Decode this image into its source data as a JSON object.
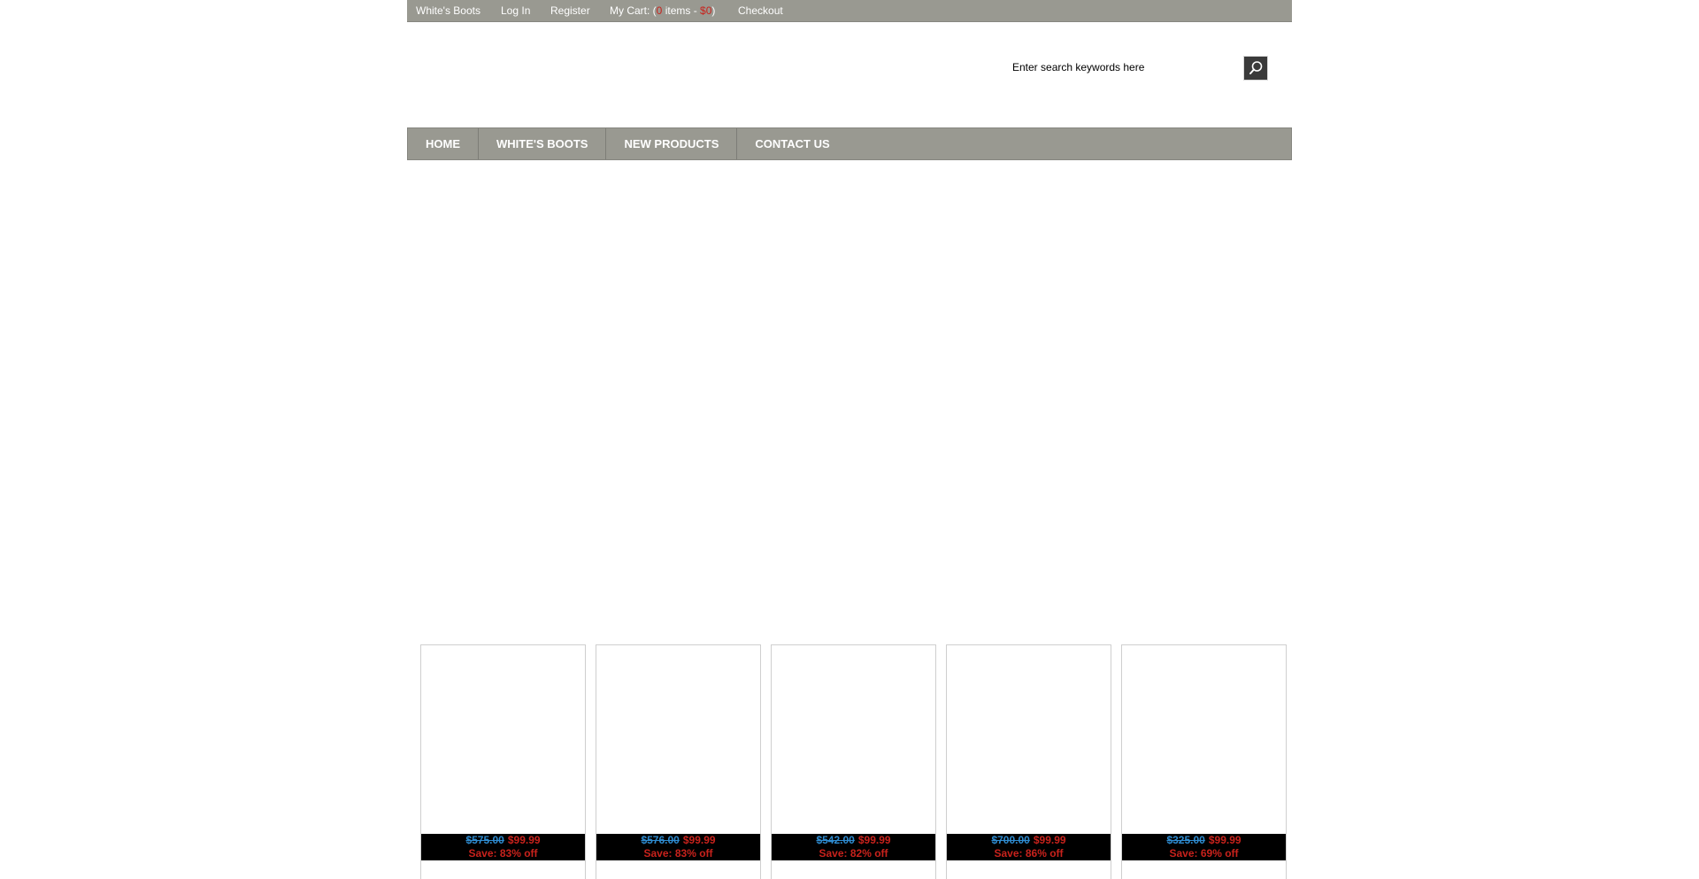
{
  "topbar": {
    "brand": "White's Boots",
    "login": "Log In",
    "register": "Register",
    "cart_prefix": "My Cart: (",
    "cart_count": "0",
    "cart_middle": " items - ",
    "cart_total": "$0",
    "cart_suffix": ")",
    "checkout": "Checkout"
  },
  "search": {
    "value": "Enter search keywords here",
    "icon": "magnifier-icon"
  },
  "nav": {
    "items": [
      "Home",
      "White's Boots",
      "New Products",
      "Contact Us"
    ]
  },
  "products": [
    {
      "old_price": "$575.00",
      "price": "$99.99",
      "save": "Save: 83% off"
    },
    {
      "old_price": "$576.00",
      "price": "$99.99",
      "save": "Save: 83% off"
    },
    {
      "old_price": "$542.00",
      "price": "$99.99",
      "save": "Save: 82% off"
    },
    {
      "old_price": "$700.00",
      "price": "$99.99",
      "save": "Save: 86% off"
    },
    {
      "old_price": "$325.00",
      "price": "$99.99",
      "save": "Save: 69% off"
    }
  ],
  "colors": {
    "bar_gray": "#999991",
    "price_red": "#c9221c",
    "old_price_blue": "#2e8bd0"
  }
}
